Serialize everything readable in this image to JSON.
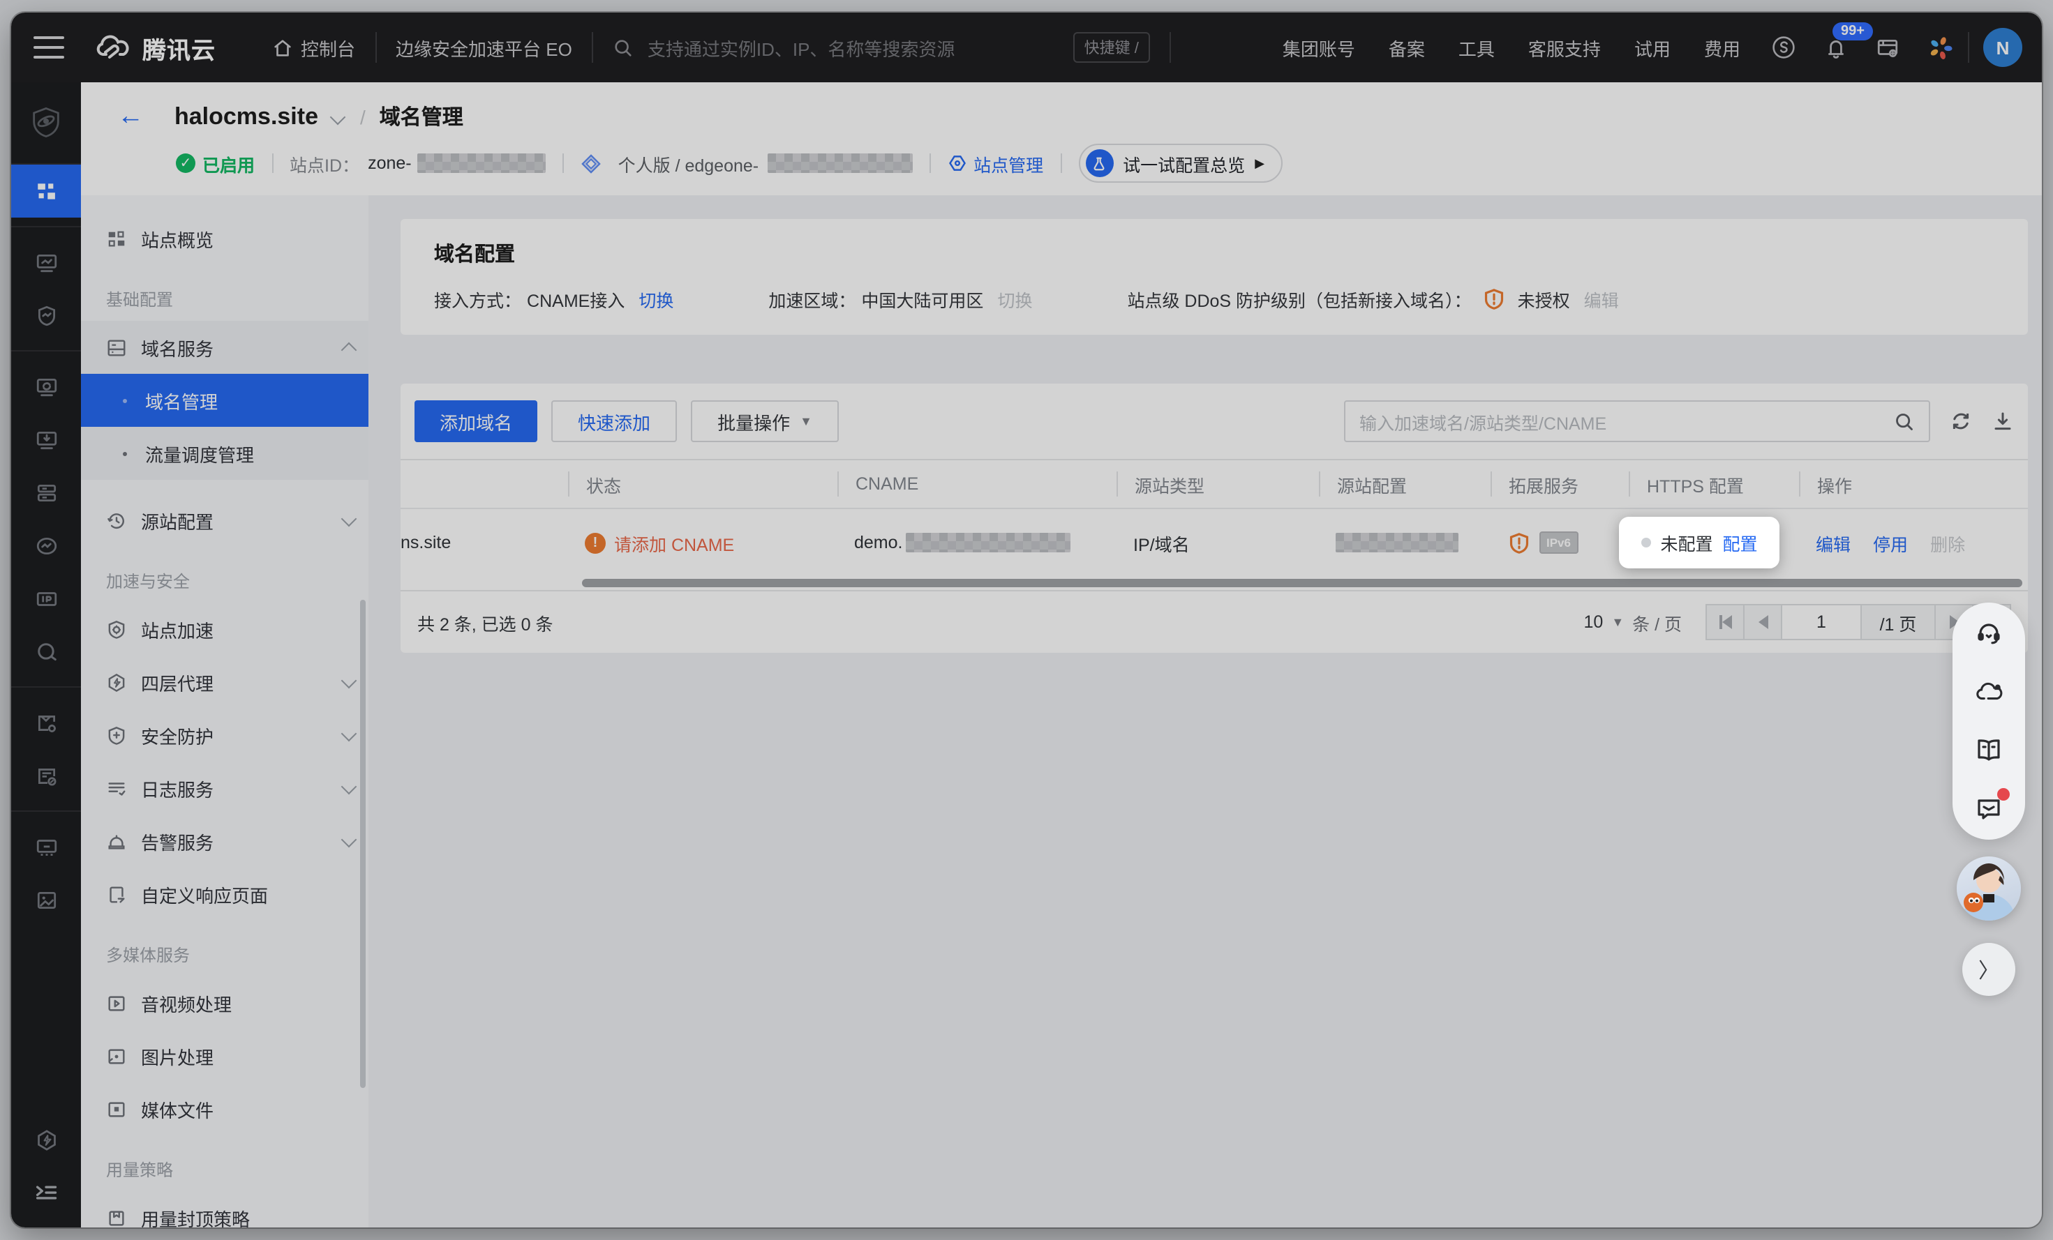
{
  "colors": {
    "primary": "#2468f2",
    "warning": "#ed7b2f",
    "success": "#12b862",
    "warn_text": "#e96749"
  },
  "nav": {
    "brand": "腾讯云",
    "console": "控制台",
    "product": "边缘安全加速平台 EO",
    "search_placeholder": "支持通过实例ID、IP、名称等搜索资源",
    "shortcut": "快捷键 /",
    "links": [
      "集团账号",
      "备案",
      "工具",
      "客服支持",
      "试用",
      "费用"
    ],
    "notify_badge": "99+",
    "avatar": "N"
  },
  "header": {
    "site": "halocms.site",
    "crumb": "域名管理",
    "status": "已启用",
    "site_id_label": "站点ID：",
    "site_id_prefix": "zone-",
    "plan": "个人版 / edgeone-",
    "site_admin": "站点管理",
    "tour": "试一试配置总览"
  },
  "sidebar": {
    "items": [
      {
        "label": "站点概览"
      },
      {
        "label": "基础配置"
      },
      {
        "label": "域名服务"
      },
      {
        "label": "域名管理"
      },
      {
        "label": "流量调度管理"
      },
      {
        "label": "源站配置"
      },
      {
        "label": "加速与安全"
      },
      {
        "label": "站点加速"
      },
      {
        "label": "四层代理"
      },
      {
        "label": "安全防护"
      },
      {
        "label": "日志服务"
      },
      {
        "label": "告警服务"
      },
      {
        "label": "自定义响应页面"
      },
      {
        "label": "多媒体服务"
      },
      {
        "label": "音视频处理"
      },
      {
        "label": "图片处理"
      },
      {
        "label": "媒体文件"
      },
      {
        "label": "用量策略"
      },
      {
        "label": "用量封顶策略"
      }
    ]
  },
  "config_card": {
    "title": "域名配置",
    "access_label": "接入方式：",
    "access_value": "CNAME接入",
    "access_action": "切换",
    "region_label": "加速区域：",
    "region_value": "中国大陆可用区",
    "region_action": "切换",
    "ddos_label": "站点级 DDoS 防护级别（包括新接入域名）：",
    "ddos_value": "未授权",
    "ddos_action": "编辑"
  },
  "table_card": {
    "add": "添加域名",
    "quick": "快速添加",
    "batch": "批量操作",
    "search_placeholder": "输入加速域名/源站类型/CNAME",
    "headers": [
      "",
      "状态",
      "CNAME",
      "源站类型",
      "源站配置",
      "拓展服务",
      "HTTPS 配置",
      "操作"
    ],
    "row": {
      "domain": "ns.site",
      "status": "请添加 CNAME",
      "cname_prefix": "demo.",
      "origin_type": "IP/域名",
      "ipv6": "IPv6",
      "https_state": "未配置",
      "https_action": "配置",
      "act_edit": "编辑",
      "act_disable": "停用",
      "act_delete": "删除"
    },
    "pagination": {
      "summary": "共 2 条, 已选 0 条",
      "size": "10",
      "unit": "条 / 页",
      "page": "1",
      "pages": "/1 页"
    }
  }
}
